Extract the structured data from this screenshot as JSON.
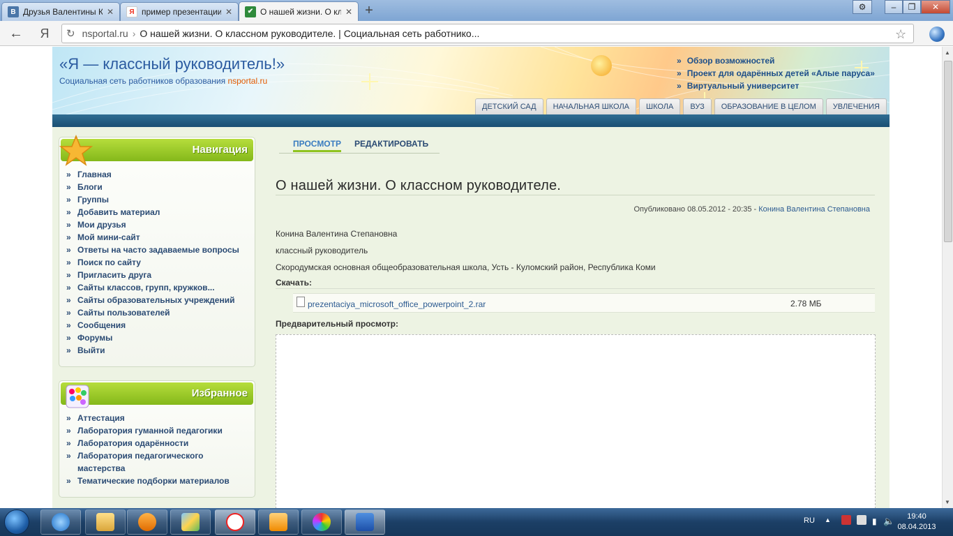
{
  "browser": {
    "tabs": [
      {
        "title": "Друзья Валентины Ко",
        "icon": "vk-icon"
      },
      {
        "title": "пример презентации",
        "icon": "yandex-icon"
      },
      {
        "title": "О нашей жизни. О кл",
        "icon": "nsportal-icon"
      }
    ],
    "address_domain": "nsportal.ru",
    "address_title": "О нашей жизни. О классном руководителе. | Социальная сеть работнико...",
    "back_label": "←",
    "yandex_label": "Я"
  },
  "site": {
    "title": "«Я — классный руководитель!»",
    "subtitle_prefix": "Социальная сеть работников образования ",
    "subtitle_brand_a": "ns",
    "subtitle_brand_b": "portal.ru",
    "top_links": [
      "Обзор возможностей",
      "Проект для одарённых детей «Алые паруса»",
      "Виртуальный университет"
    ],
    "top_tabs": [
      "ДЕТСКИЙ САД",
      "НАЧАЛЬНАЯ ШКОЛА",
      "ШКОЛА",
      "ВУЗ",
      "ОБРАЗОВАНИЕ В ЦЕЛОМ",
      "УВЛЕЧЕНИЯ"
    ]
  },
  "navigation": {
    "title": "Навигация",
    "items": [
      "Главная",
      "Блоги",
      "Группы",
      "Добавить материал",
      "Мои друзья",
      "Мой мини-сайт",
      "Ответы на часто задаваемые вопросы",
      "Поиск по сайту",
      "Пригласить друга",
      "Сайты классов, групп, кружков...",
      "Сайты образовательных учреждений",
      "Сайты пользователей",
      "Сообщения",
      "Форумы",
      "Выйти"
    ]
  },
  "favorites": {
    "title": "Избранное",
    "items": [
      "Аттестация",
      "Лаборатория гуманной педагогики",
      "Лаборатория одарённости",
      "Лаборатория педагогического мастерства",
      "Тематические подборки материалов"
    ]
  },
  "content": {
    "tab_view": "ПРОСМОТР",
    "tab_edit": "РЕДАКТИРОВАТЬ",
    "title": "О нашей жизни. О классном руководителе.",
    "published": "Опубликовано 08.05.2012 - 20:35 - ",
    "author_link": "Конина Валентина Степановна",
    "author": "Конина Валентина Степановна",
    "role": "классный руководитель",
    "school": "Скородумская основная общеобразовательная школа, Усть - Куломский район, Республика Коми",
    "download_label": "Скачать:",
    "file_name": "prezentaciya_microsoft_office_powerpoint_2.rar",
    "file_size": "2.78 МБ",
    "preview_label": "Предварительный просмотр:"
  },
  "taskbar": {
    "lang": "RU",
    "time": "19:40",
    "date": "08.04.2013",
    "apps": [
      "ie-icon",
      "explorer-icon",
      "media-player-icon",
      "paint-icon",
      "yandex-browser-icon",
      "outlook-icon",
      "picasa-icon",
      "word-icon"
    ]
  }
}
